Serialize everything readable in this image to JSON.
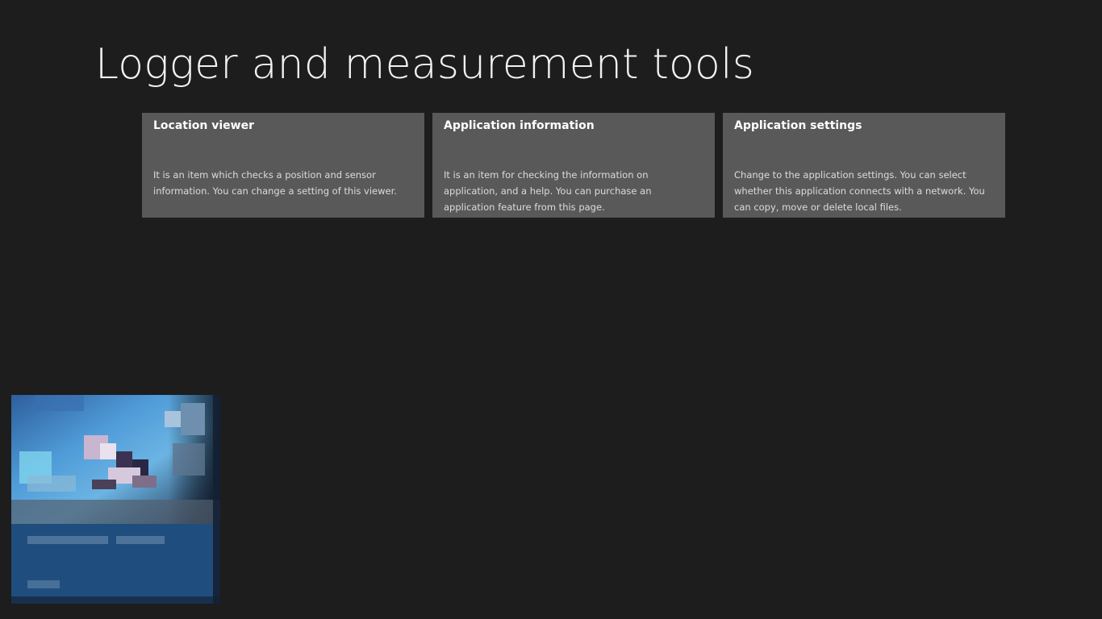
{
  "page": {
    "title": "Logger and measurement tools"
  },
  "tiles": [
    {
      "title": "Location viewer",
      "description": "It is an item which checks a position and sensor information. You can change a setting of this viewer."
    },
    {
      "title": "Application information",
      "description": "It is an item for checking the information on application, and a help. You can purchase an application feature from this page."
    },
    {
      "title": "Application settings",
      "description": "Change to the application settings. You can select whether this application connects with a network. You can copy, move or delete local files."
    }
  ],
  "colors": {
    "background": "#1d1d1d",
    "tile": "#595959",
    "thumbnail_panel": "#1f4e7e"
  }
}
